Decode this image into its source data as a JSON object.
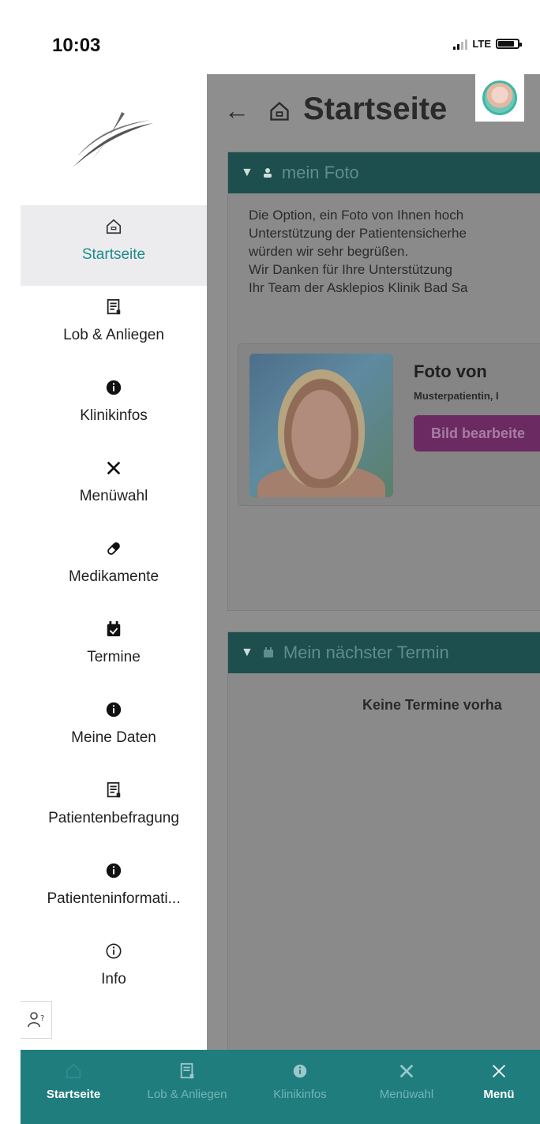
{
  "status_bar": {
    "time": "10:03",
    "network": "LTE",
    "battery_level": 0.85
  },
  "main": {
    "title": "Startseite",
    "photo_card": {
      "header": "mein Foto",
      "text_lines": [
        "Die Option, ein Foto von Ihnen hoch",
        "Unterstützung der Patientensicherhe",
        "würden wir sehr begrüßen.",
        "Wir Danken für Ihre Unterstützung",
        "Ihr Team der Asklepios Klinik Bad Sa"
      ],
      "photo_title": "Foto von",
      "photo_subtitle": "Musterpatientin, I",
      "edit_button": "Bild bearbeite"
    },
    "appointment_card": {
      "header": "Mein nächster Termin",
      "empty_text": "Keine Termine vorha"
    }
  },
  "drawer": {
    "items": [
      {
        "label": "Startseite",
        "icon": "home-icon",
        "active": true
      },
      {
        "label": "Lob & Anliegen",
        "icon": "document-icon"
      },
      {
        "label": "Klinikinfos",
        "icon": "info-filled-icon"
      },
      {
        "label": "Menüwahl",
        "icon": "cutlery-icon"
      },
      {
        "label": "Medikamente",
        "icon": "pill-icon"
      },
      {
        "label": "Termine",
        "icon": "calendar-check-icon"
      },
      {
        "label": "Meine Daten",
        "icon": "info-filled-icon"
      },
      {
        "label": "Patientenbefragung",
        "icon": "document-icon"
      },
      {
        "label": "Patienteninformati...",
        "icon": "info-filled-icon"
      },
      {
        "label": "Info",
        "icon": "info-outline-icon"
      }
    ]
  },
  "bottom_bar": {
    "tabs": [
      {
        "label": "Startseite",
        "icon": "home-icon"
      },
      {
        "label": "Lob & Anliegen",
        "icon": "document-icon"
      },
      {
        "label": "Klinikinfos",
        "icon": "info-filled-icon"
      },
      {
        "label": "Menüwahl",
        "icon": "cutlery-icon"
      },
      {
        "label": "Menü",
        "icon": "close-icon"
      }
    ]
  },
  "colors": {
    "brand_teal": "#1f7d7e",
    "active_text": "#1e8b8e",
    "edit_button": "#b0359f"
  }
}
